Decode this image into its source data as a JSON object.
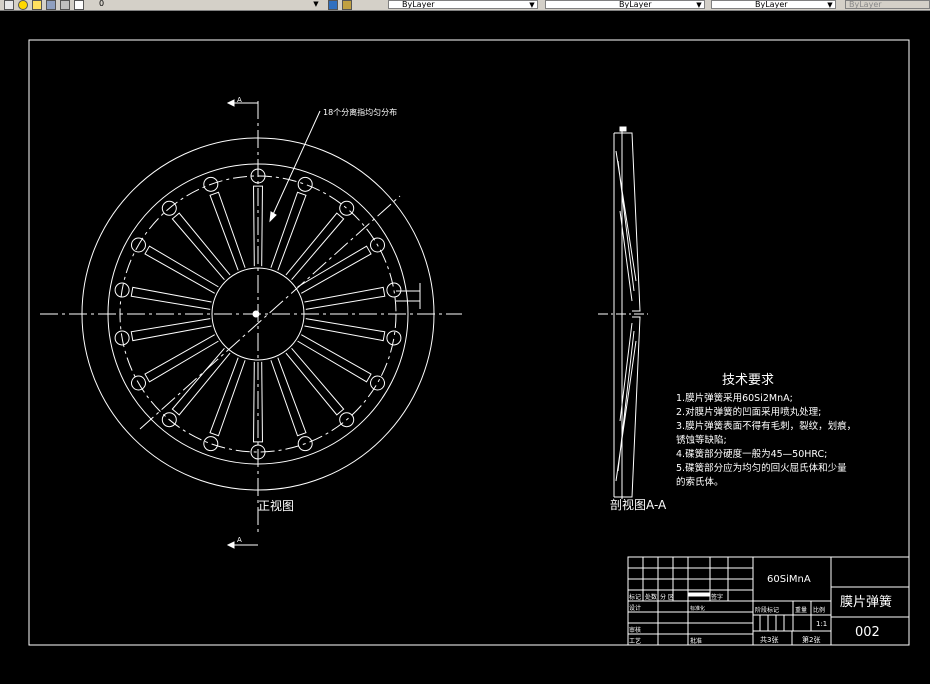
{
  "toolbar": {
    "layer_value": "0",
    "color_value": "ByLayer",
    "linetype_value": "ByLayer",
    "lineweight_value": "ByLayer",
    "plotstyle_value": "ByLayer"
  },
  "drawing": {
    "note_fingers": "18个分离指均匀分布",
    "front_view_label": "正视图",
    "section_view_label": "剖视图A-A",
    "section_mark": "A",
    "tech": {
      "title": "技术要求",
      "lines": [
        "1.膜片弹簧采用60Si2MnA;",
        "2.对膜片弹簧的凹面采用喷丸处理;",
        "3.膜片弹簧表面不得有毛刺，裂纹，划痕，",
        "锈蚀等缺陷;",
        "4.碟簧部分硬度一般为45—50HRC;",
        "5.碟簧部分应为均匀的回火屈氏体和少量",
        "的索氏体。"
      ]
    },
    "title_block": {
      "material": "60SiMnA",
      "part_name": "膜片弹簧",
      "drawing_no": "002",
      "scale": "1:1",
      "sheets_total": "共3张",
      "sheet_no": "第2张",
      "label_revision": "标记",
      "label_count": "处数",
      "label_zone": "分 区",
      "label_signature": "签字",
      "label_design": "设计",
      "label_standard": "标准化",
      "label_review": "审核",
      "label_process": "工艺",
      "label_approve": "批准",
      "label_stage": "阶段标记",
      "label_weight": "重量",
      "label_ratio": "比例"
    }
  }
}
